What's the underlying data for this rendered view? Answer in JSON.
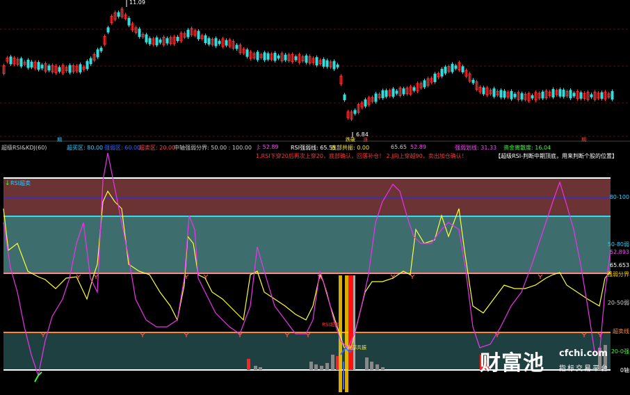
{
  "upper_panel": {
    "price_high_label": "11.09",
    "price_low_label": "6.84",
    "bottom_markers": [
      {
        "text": "期",
        "color": "#33ccff"
      },
      {
        "text": "跌破",
        "color": "#ffee33"
      },
      {
        "text": "涨",
        "color": "#ff4444"
      },
      {
        "text": "期",
        "color": "#ff4444"
      }
    ]
  },
  "indicator_header": {
    "name": "超级RSI&KDJ(60)",
    "chao_mai_qu_label": "超买区",
    "chao_mai_qu_value": "80.00",
    "items": [
      {
        "text": "超买区: 80.00",
        "color": "#33ccff"
      },
      {
        "text": "强弱区: 60.00",
        "color": "#3366ff"
      },
      {
        "text": "超卖区: 20.00",
        "color": "#ff4444"
      },
      {
        "text": "中轴强弱分界: 50.00 : 100.00",
        "color": "#cccccc"
      },
      {
        "text": "J: 52.89",
        "color": "#ff44ff"
      },
      {
        "text": "RSI强弱线: 65.55",
        "color": "#ffffff"
      },
      {
        "text": "底部共振: 0.00",
        "color": "#ffee33"
      },
      {
        "text": "65.65",
        "color": "#cccccc"
      },
      {
        "text": "52.89",
        "color": "#ff44ff"
      },
      {
        "text": "强弱划线: 31.33",
        "color": "#ff44ff"
      },
      {
        "text": "资金离散度: 16.04",
        "color": "#33ff33"
      }
    ],
    "condition_text": "1.RSI下穿20后再次上穿20，底部确认，回落补仓！ 2.J向上穿越90，卖出加仓确认！",
    "hint_text": "【超级RSI-判断中期顶底，用来判断个股的位置】"
  },
  "lower_panel": {
    "legend_label": "RSI超卖",
    "signal_labels": [
      {
        "text": "RSI超卖",
        "color": "#ff3333"
      },
      {
        "text": "底部共振",
        "color": "#ffee33"
      }
    ],
    "axis_labels": [
      {
        "text": "80-100",
        "color": "#33ccff"
      },
      {
        "text": "50-80弱",
        "color": "#33ccff"
      },
      {
        "text": "65.653",
        "color": "#ffffff"
      },
      {
        "text": "52.893",
        "color": "#ff44ff"
      },
      {
        "text": "强弱分界",
        "color": "#ffcc00"
      },
      {
        "text": "20-50弱",
        "color": "#cccccc"
      },
      {
        "text": "超卖线",
        "color": "#ff8833"
      },
      {
        "text": "20-0强",
        "color": "#33ff33"
      },
      {
        "text": "0轴",
        "color": "#ffffff"
      }
    ]
  },
  "watermark": {
    "logo_text": "财富池",
    "domain_text": "cfchi.com",
    "slogan_text": "指标交易平台"
  }
}
